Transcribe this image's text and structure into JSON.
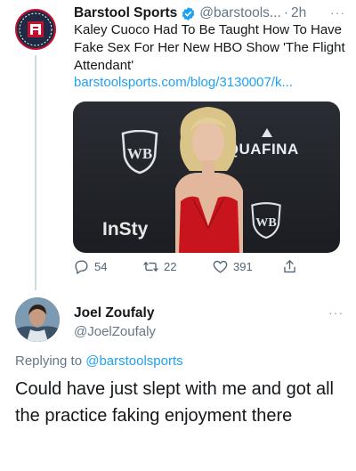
{
  "tweet": {
    "author_name": "Barstool Sports",
    "handle": "@barstools...",
    "separator": "·",
    "time": "2h",
    "more": "···",
    "text": "Kaley Cuoco Had To Be Taught How To Have Fake Sex For Her New HBO Show 'The Flight Attendant'",
    "link": "barstoolsports.com/blog/3130007/k...",
    "media": {
      "backdrop_logo_1": "WB",
      "backdrop_logo_2": "WB",
      "brand_1": "AQUAFINA",
      "brand_2": "InSty"
    },
    "stats": {
      "replies": "54",
      "retweets": "22",
      "likes": "391"
    },
    "colors": {
      "verified": "#1da1f2",
      "link": "#1da1f2",
      "dress": "#c8151d"
    }
  },
  "reply": {
    "author_name": "Joel Zoufaly",
    "handle": "@JoelZoufaly",
    "more": "···",
    "replying_prefix": "Replying to",
    "replying_to": "@barstoolsports",
    "text": "Could have just slept with me and got all the practice faking enjoyment there"
  },
  "icons": {
    "avatar": "barstool-logo",
    "verified": "verified-badge-icon",
    "reply": "reply-icon",
    "retweet": "retweet-icon",
    "like": "heart-icon",
    "share": "share-icon"
  }
}
